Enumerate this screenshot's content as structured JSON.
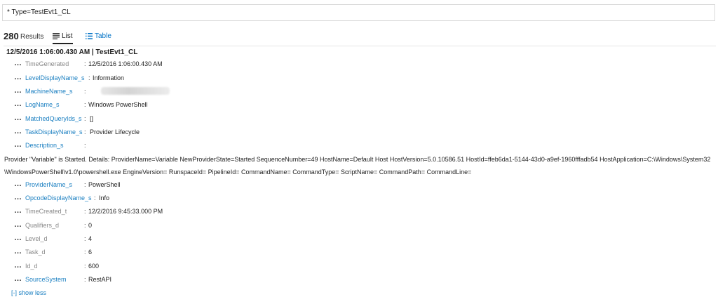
{
  "query": {
    "value": "* Type=TestEvt1_CL"
  },
  "results": {
    "count": "280",
    "label": "Results"
  },
  "tabs": {
    "list": "List",
    "table": "Table"
  },
  "record": {
    "header": "12/5/2016 1:06:00.430 AM | TestEvt1_CL",
    "fields": [
      {
        "name": "TimeGenerated",
        "value": "12/5/2016 1:06:00.430 AM"
      },
      {
        "name": "LevelDisplayName_s",
        "value": "Information"
      },
      {
        "name": "MachineName_s",
        "value": ""
      },
      {
        "name": "LogName_s",
        "value": "Windows PowerShell"
      },
      {
        "name": "MatchedQueryIds_s",
        "value": "[]"
      },
      {
        "name": "TaskDisplayName_s",
        "value": "Provider Lifecycle"
      },
      {
        "name": "Description_s",
        "value": ""
      },
      {
        "name": "ProviderName_s",
        "value": "PowerShell"
      },
      {
        "name": "OpcodeDisplayName_s",
        "value": "Info"
      },
      {
        "name": "TimeCreated_t",
        "value": "12/2/2016 9:45:33.000 PM"
      },
      {
        "name": "Qualifiers_d",
        "value": "0"
      },
      {
        "name": "Level_d",
        "value": "4"
      },
      {
        "name": "Task_d",
        "value": "6"
      },
      {
        "name": "Id_d",
        "value": "600"
      },
      {
        "name": "SourceSystem",
        "value": "RestAPI"
      }
    ],
    "description_line1": "Provider \"Variable\" is Started. Details: ProviderName=Variable NewProviderState=Started SequenceNumber=49 HostName=Default Host HostVersion=5.0.10586.51 HostId=ffeb6da1-5144-43d0-a9ef-1960fffadb54 HostApplication=C:\\Windows\\System32",
    "description_line2": "\\WindowsPowerShell\\v1.0\\powershell.exe EngineVersion= RunspaceId= PipelineId= CommandName= CommandType= ScriptName= CommandPath= CommandLine="
  },
  "show_less": "[-] show less",
  "colors": {
    "link": "#1a7fc1",
    "table_tab": "#0072c6",
    "field_plain": "#888888"
  }
}
